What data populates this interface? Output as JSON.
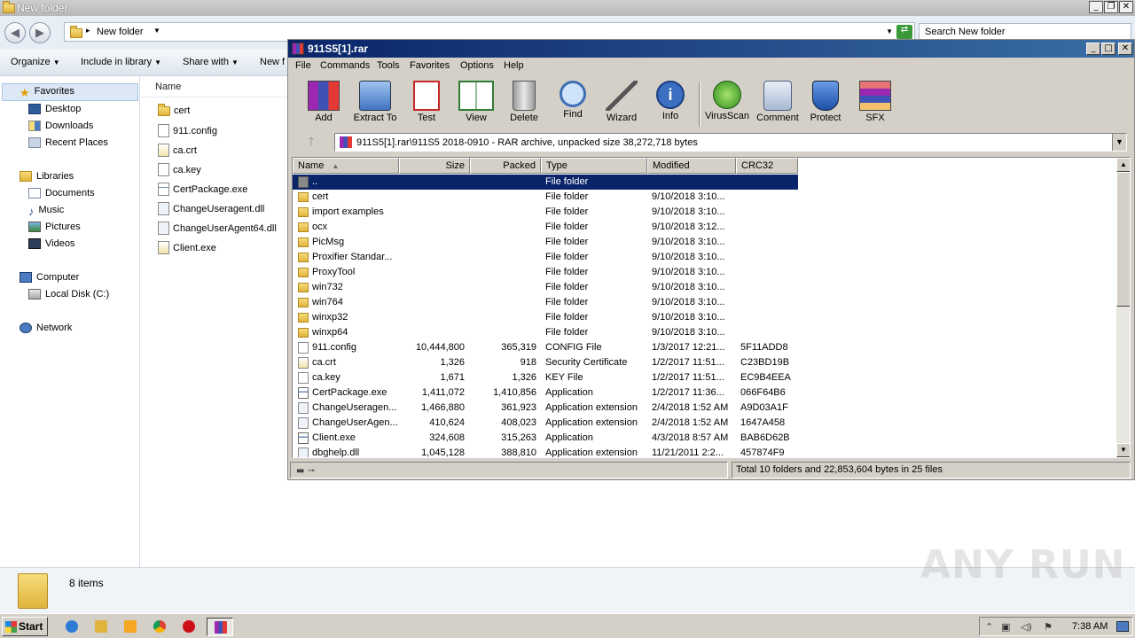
{
  "explorer": {
    "title": "New folder",
    "address_crumb": "New folder",
    "search_placeholder": "Search New folder",
    "commands": [
      "Organize",
      "Include in library",
      "Share with",
      "New f"
    ],
    "sidebar": {
      "favorites": "Favorites",
      "favorite_items": [
        "Desktop",
        "Downloads",
        "Recent Places"
      ],
      "libraries": "Libraries",
      "library_items": [
        "Documents",
        "Music",
        "Pictures",
        "Videos"
      ],
      "computer": "Computer",
      "computer_items": [
        "Local Disk (C:)"
      ],
      "network": "Network"
    },
    "column_name": "Name",
    "files": [
      "cert",
      "911.config",
      "ca.crt",
      "ca.key",
      "CertPackage.exe",
      "ChangeUseragent.dll",
      "ChangeUserAgent64.dll",
      "Client.exe"
    ],
    "status_count": "8 items"
  },
  "rar": {
    "title": "911S5[1].rar",
    "menu": [
      "File",
      "Commands",
      "Tools",
      "Favorites",
      "Options",
      "Help"
    ],
    "toolbar": [
      "Add",
      "Extract To",
      "Test",
      "View",
      "Delete",
      "Find",
      "Wizard",
      "Info",
      "VirusScan",
      "Comment",
      "Protect",
      "SFX"
    ],
    "path": "911S5[1].rar\\911S5 2018-0910 - RAR archive, unpacked size 38,272,718 bytes",
    "columns": [
      "Name",
      "Size",
      "Packed",
      "Type",
      "Modified",
      "CRC32"
    ],
    "rows": [
      {
        "name": "..",
        "size": "",
        "packed": "",
        "type": "File folder",
        "modified": "",
        "crc": "",
        "icon": "up"
      },
      {
        "name": "cert",
        "size": "",
        "packed": "",
        "type": "File folder",
        "modified": "9/10/2018 3:10...",
        "crc": "",
        "icon": "folder"
      },
      {
        "name": "import examples",
        "size": "",
        "packed": "",
        "type": "File folder",
        "modified": "9/10/2018 3:10...",
        "crc": "",
        "icon": "folder"
      },
      {
        "name": "ocx",
        "size": "",
        "packed": "",
        "type": "File folder",
        "modified": "9/10/2018 3:12...",
        "crc": "",
        "icon": "folder"
      },
      {
        "name": "PicMsg",
        "size": "",
        "packed": "",
        "type": "File folder",
        "modified": "9/10/2018 3:10...",
        "crc": "",
        "icon": "folder"
      },
      {
        "name": "Proxifier Standar...",
        "size": "",
        "packed": "",
        "type": "File folder",
        "modified": "9/10/2018 3:10...",
        "crc": "",
        "icon": "folder"
      },
      {
        "name": "ProxyTool",
        "size": "",
        "packed": "",
        "type": "File folder",
        "modified": "9/10/2018 3:10...",
        "crc": "",
        "icon": "folder"
      },
      {
        "name": "win732",
        "size": "",
        "packed": "",
        "type": "File folder",
        "modified": "9/10/2018 3:10...",
        "crc": "",
        "icon": "folder"
      },
      {
        "name": "win764",
        "size": "",
        "packed": "",
        "type": "File folder",
        "modified": "9/10/2018 3:10...",
        "crc": "",
        "icon": "folder"
      },
      {
        "name": "winxp32",
        "size": "",
        "packed": "",
        "type": "File folder",
        "modified": "9/10/2018 3:10...",
        "crc": "",
        "icon": "folder"
      },
      {
        "name": "winxp64",
        "size": "",
        "packed": "",
        "type": "File folder",
        "modified": "9/10/2018 3:10...",
        "crc": "",
        "icon": "folder"
      },
      {
        "name": "911.config",
        "size": "10,444,800",
        "packed": "365,319",
        "type": "CONFIG File",
        "modified": "1/3/2017 12:21...",
        "crc": "5F11ADD8",
        "icon": "file"
      },
      {
        "name": "ca.crt",
        "size": "1,326",
        "packed": "918",
        "type": "Security Certificate",
        "modified": "1/2/2017 11:51...",
        "crc": "C23BD19B",
        "icon": "crt"
      },
      {
        "name": "ca.key",
        "size": "1,671",
        "packed": "1,326",
        "type": "KEY File",
        "modified": "1/2/2017 11:51...",
        "crc": "EC9B4EEA",
        "icon": "file"
      },
      {
        "name": "CertPackage.exe",
        "size": "1,411,072",
        "packed": "1,410,856",
        "type": "Application",
        "modified": "1/2/2017 11:36...",
        "crc": "066F64B6",
        "icon": "app"
      },
      {
        "name": "ChangeUseragen...",
        "size": "1,466,880",
        "packed": "361,923",
        "type": "Application extension",
        "modified": "2/4/2018 1:52 AM",
        "crc": "A9D03A1F",
        "icon": "dll"
      },
      {
        "name": "ChangeUserAgen...",
        "size": "410,624",
        "packed": "408,023",
        "type": "Application extension",
        "modified": "2/4/2018 1:52 AM",
        "crc": "1647A458",
        "icon": "dll"
      },
      {
        "name": "Client.exe",
        "size": "324,608",
        "packed": "315,263",
        "type": "Application",
        "modified": "4/3/2018 8:57 AM",
        "crc": "BAB6D62B",
        "icon": "app"
      },
      {
        "name": "dbghelp.dll",
        "size": "1,045,128",
        "packed": "388,810",
        "type": "Application extension",
        "modified": "11/21/2011 2:2...",
        "crc": "457874F9",
        "icon": "dll"
      }
    ],
    "status_total": "Total 10 folders and 22,853,604 bytes in 25 files"
  },
  "watermark": "ANY RUN",
  "taskbar": {
    "start": "Start",
    "clock": "7:38 AM"
  }
}
